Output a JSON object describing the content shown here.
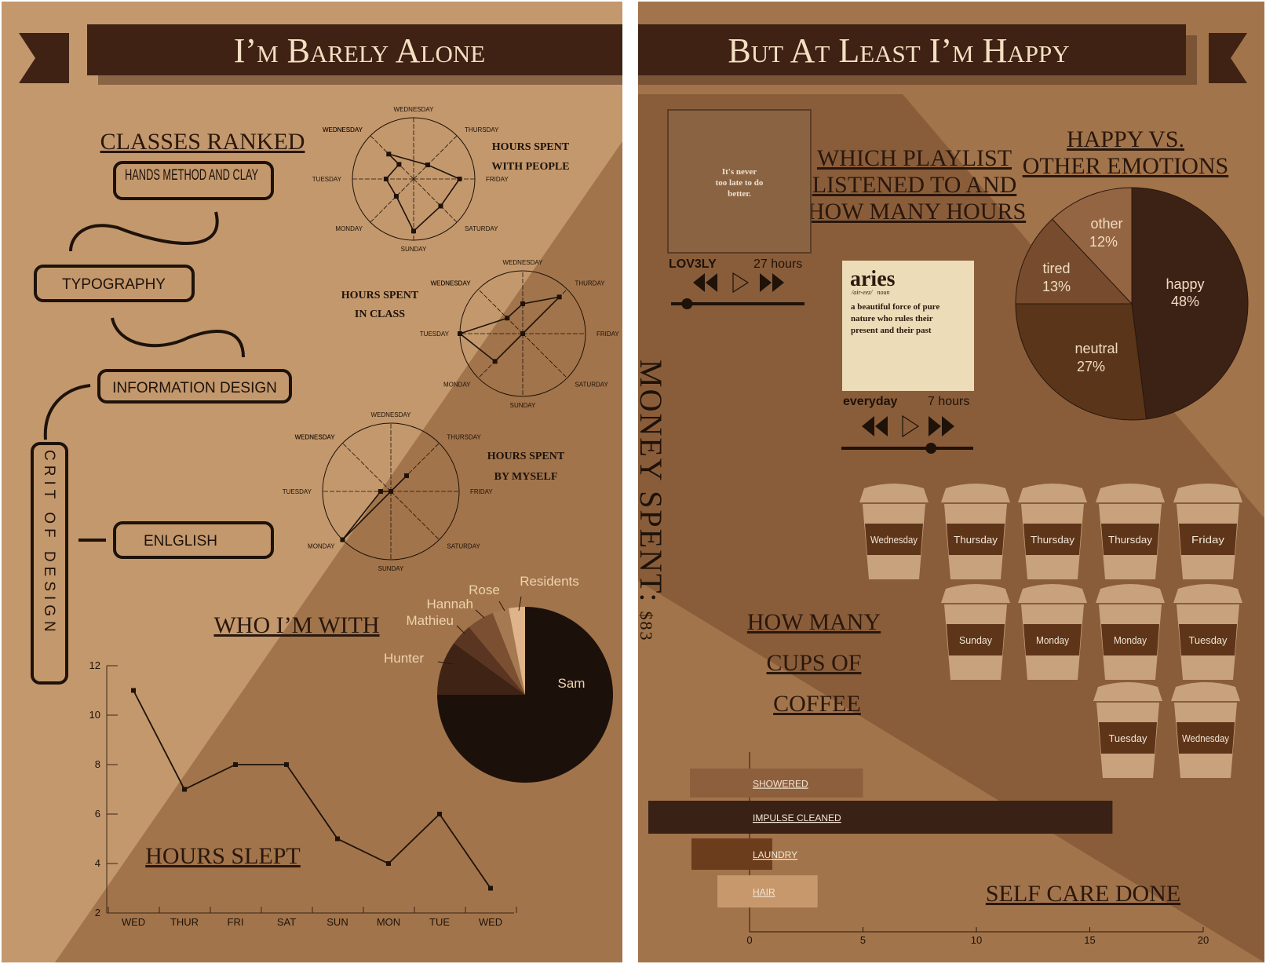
{
  "header": {
    "left_title": "I’m Barely Alone",
    "right_title": "But At Least I’m Happy"
  },
  "colors": {
    "light_tan": "#c3986d",
    "mid_brown": "#a2744b",
    "dark_panel": "#8a5d3a",
    "banner": "#3f2214",
    "ink": "#1e1209"
  },
  "classes": {
    "title": "CLASSES RANKED",
    "items": [
      "HANDS METHOD AND CLAY",
      "TYPOGRAPHY",
      "INFORMATION DESIGN",
      "ENLGLISH"
    ],
    "vertical_item": "CRIT OF DESIGN"
  },
  "radar_charts": {
    "days": [
      "WEDNESDAY",
      "THURSDAY",
      "FRIDAY",
      "SATURDAY",
      "SUNDAY",
      "MONDAY",
      "TUESDAY",
      "WEDNESDAY"
    ],
    "with_people": {
      "title_line1": "HOURS SPENT",
      "title_line2": "WITH PEOPLE",
      "thursday_label": "THURSDAY"
    },
    "in_class": {
      "title_line1": "HOURS SPENT",
      "title_line2": "IN CLASS",
      "thursday_label": "THURDAY"
    },
    "by_myself": {
      "title_line1": "HOURS SPENT",
      "title_line2": "BY MYSELF",
      "thursday_label": "THURSDAY"
    }
  },
  "who_with": {
    "title": "WHO I’M WITH",
    "slices": [
      {
        "label": "Sam",
        "percent": 75,
        "color": "#1c100b"
      },
      {
        "label": "Hunter",
        "percent": 10,
        "color": "#3f2416"
      },
      {
        "label": "Mathieu",
        "percent": 4,
        "color": "#5a3521"
      },
      {
        "label": "Hannah",
        "percent": 5,
        "color": "#7b4f31"
      },
      {
        "label": "Rose",
        "percent": 3,
        "color": "#a57a53"
      },
      {
        "label": "Residents",
        "percent": 3,
        "color": "#e0b48a"
      }
    ]
  },
  "hours_slept": {
    "title": "HOURS SLEPT",
    "chart_data": {
      "type": "line",
      "categories": [
        "WED",
        "THUR",
        "FRI",
        "SAT",
        "SUN",
        "MON",
        "TUE",
        "WED"
      ],
      "values": [
        11,
        7,
        8,
        8,
        5,
        4,
        6,
        3
      ],
      "ylim": [
        2,
        12
      ],
      "yticks": [
        "2",
        "4",
        "6",
        "8",
        "10",
        "12"
      ]
    }
  },
  "money": {
    "label": "MONEY SPENT:",
    "value": "$83"
  },
  "playlist": {
    "title": "WHICH PLAYLIST LISTENED TO AND HOW MANY HOURS",
    "album1": {
      "cover_text": "It's never too late to do better.",
      "name": "LOV3LY",
      "hours": "27 hours",
      "progress": 0.12
    },
    "album2": {
      "word": "aries",
      "pron": "/air-eez/",
      "pos": "noun",
      "definition": "a beautiful force of pure nature who rules their present and their past",
      "name": "everyday",
      "hours": "7 hours",
      "progress": 0.68
    }
  },
  "emotions": {
    "title_line1": "HAPPY VS.",
    "title_line2": "OTHER EMOTIONS",
    "slices": [
      {
        "label": "happy",
        "value": "48%",
        "percent": 48,
        "color": "#3c2215"
      },
      {
        "label": "neutral",
        "value": "27%",
        "percent": 27,
        "color": "#5a3519"
      },
      {
        "label": "tired",
        "value": "13%",
        "percent": 13,
        "color": "#774c2e"
      },
      {
        "label": "other",
        "value": "12%",
        "percent": 12,
        "color": "#946542"
      }
    ]
  },
  "coffee": {
    "title_line1": "HOW MANY",
    "title_line2": "CUPS OF",
    "title_line3": "COFFEE",
    "cups": [
      "Wednesday",
      "Thursday",
      "Thursday",
      "Thursday",
      "Friday",
      "Sunday",
      "Monday",
      "Monday",
      "Tuesday",
      "Tuesday",
      "Wednesday"
    ]
  },
  "self_care": {
    "title": "SELF CARE DONE",
    "chart_data": {
      "type": "bar",
      "categories": [
        "SHOWERED",
        "IMPULSE CLEANED",
        "LAUNDRY",
        "HAIR"
      ],
      "values": [
        5,
        16,
        1,
        3
      ],
      "xlim": [
        0,
        20
      ],
      "xticks": [
        "0",
        "5",
        "10",
        "15",
        "20"
      ]
    }
  }
}
